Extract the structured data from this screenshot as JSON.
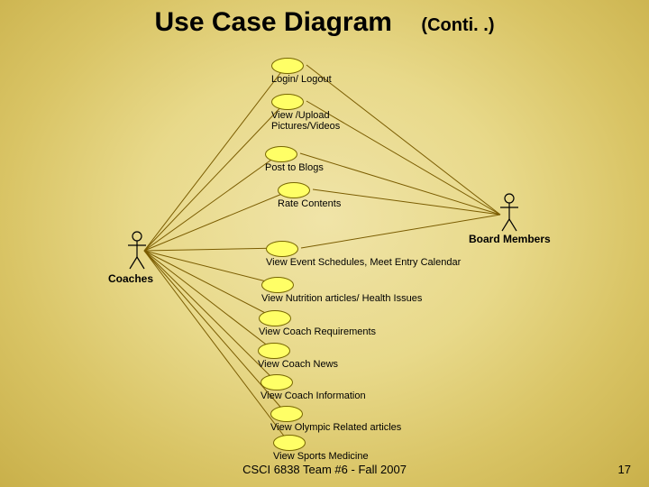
{
  "title": "Use Case Diagram",
  "subtitle": "(Conti. .)",
  "actors": {
    "left": "Coaches",
    "right": "Board Members"
  },
  "usecases": [
    "Login/ Logout",
    "View /Upload Pictures/Videos",
    "Post to Blogs",
    "Rate Contents",
    "View Event Schedules, Meet Entry Calendar",
    "View Nutrition articles/ Health Issues",
    "View Coach Requirements",
    "View Coach News",
    "View Coach Information",
    "View Olympic Related articles",
    "View Sports Medicine"
  ],
  "footer": "CSCI 6838  Team #6  -  Fall 2007",
  "page": "17"
}
